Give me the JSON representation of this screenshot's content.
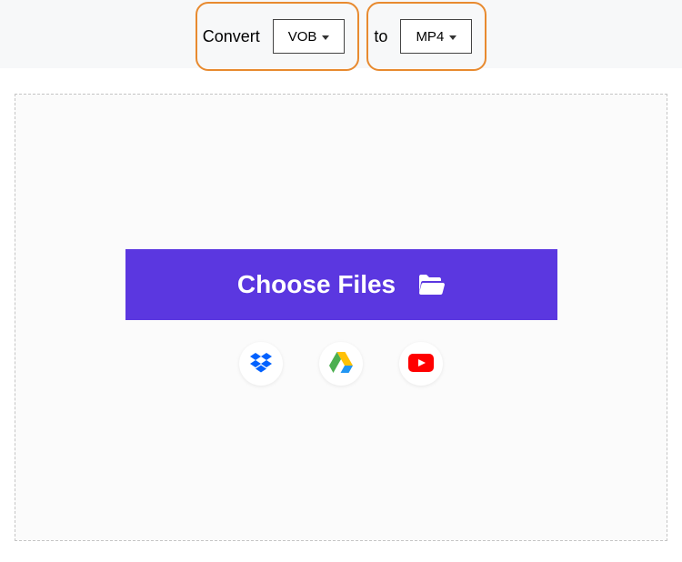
{
  "topbar": {
    "convert_label": "Convert",
    "to_label": "to",
    "from_format": "VOB",
    "to_format": "MP4"
  },
  "dropzone": {
    "choose_label": "Choose Files"
  },
  "sources": {
    "dropbox": "Dropbox",
    "gdrive": "Google Drive",
    "youtube": "YouTube"
  },
  "colors": {
    "accent_orange": "#e88a2f",
    "primary": "#5b37e0"
  }
}
